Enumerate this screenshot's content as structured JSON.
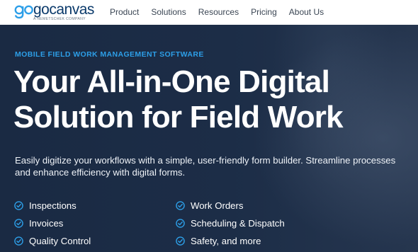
{
  "brand": {
    "name": "gocanvas",
    "tagline": "A NEMETSCHEK COMPANY",
    "colors": {
      "logo_mark": "#2d9fe8",
      "logo_word": "#0b3a6b"
    }
  },
  "nav": {
    "items": [
      {
        "label": "Product"
      },
      {
        "label": "Solutions"
      },
      {
        "label": "Resources"
      },
      {
        "label": "Pricing"
      },
      {
        "label": "About Us"
      }
    ]
  },
  "hero": {
    "kicker": "MOBILE FIELD WORK MANAGEMENT SOFTWARE",
    "headline_line1": "Your All-in-One Digital",
    "headline_line2": "Solution for Field Work",
    "subtext": "Easily digitize your workflows with a simple, user-friendly form builder. Streamline processes and enhance efficiency with digital forms.",
    "features_left": [
      {
        "label": "Inspections",
        "icon": "check-circle-icon"
      },
      {
        "label": "Invoices",
        "icon": "check-circle-icon"
      },
      {
        "label": "Quality Control",
        "icon": "check-circle-icon"
      }
    ],
    "features_right": [
      {
        "label": "Work Orders",
        "icon": "check-circle-icon"
      },
      {
        "label": "Scheduling & Dispatch",
        "icon": "check-circle-icon"
      },
      {
        "label": "Safety, and more",
        "icon": "check-circle-icon"
      }
    ],
    "colors": {
      "background": "#1c2c44",
      "accent": "#2d9fe8",
      "text": "#ffffff"
    }
  }
}
